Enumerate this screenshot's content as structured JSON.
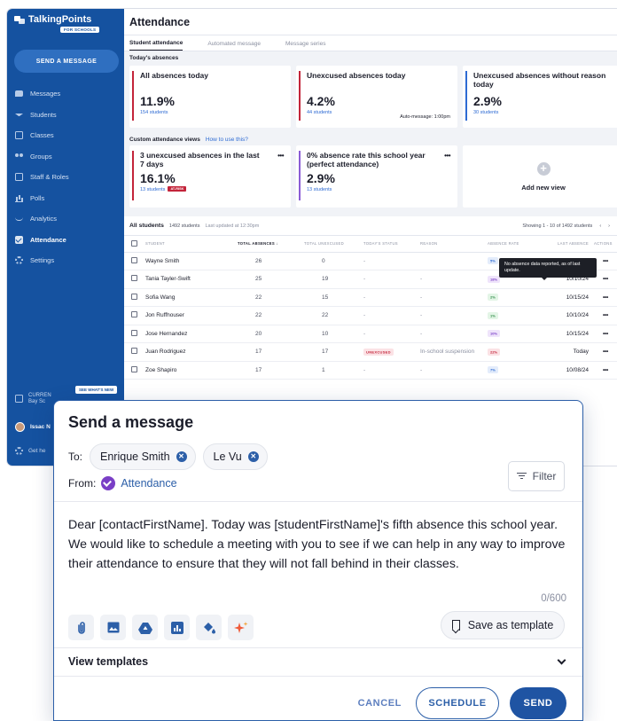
{
  "sidebar": {
    "logo": "TalkingPoints",
    "logo_sub": "FOR SCHOOLS",
    "send_button": "SEND A MESSAGE",
    "items": [
      {
        "label": "Messages",
        "icon": "messages-icon"
      },
      {
        "label": "Students",
        "icon": "students-icon"
      },
      {
        "label": "Classes",
        "icon": "classes-icon"
      },
      {
        "label": "Groups",
        "icon": "groups-icon"
      },
      {
        "label": "Staff & Roles",
        "icon": "staff-icon"
      },
      {
        "label": "Polls",
        "icon": "polls-icon"
      },
      {
        "label": "Analytics",
        "icon": "analytics-icon"
      },
      {
        "label": "Attendance",
        "icon": "attendance-icon",
        "active": true
      },
      {
        "label": "Settings",
        "icon": "settings-icon"
      }
    ],
    "whats_new": "SEE WHAT'S NEW",
    "current_label": "CURREN",
    "current_school": "Bay Sc",
    "user_name": "Issac N",
    "help": "Get he"
  },
  "header": {
    "title": "Attendance",
    "tabs": [
      "Student attendance",
      "Automated message",
      "Message series"
    ]
  },
  "today": {
    "heading": "Today's absences",
    "cards": [
      {
        "title": "All absences today",
        "value": "11.9%",
        "sub": "154 students",
        "note": ""
      },
      {
        "title": "Unexcused absences today",
        "value": "4.2%",
        "sub": "44 students",
        "note": "Auto-message: 1:00pm"
      },
      {
        "title": "Unexcused absences without reason today",
        "value": "2.9%",
        "sub": "30 students",
        "note": ""
      }
    ]
  },
  "custom": {
    "heading": "Custom attendance views",
    "link": "How to use this?",
    "cards": [
      {
        "title": "3 unexcused absences in the last 7 days",
        "value": "16.1%",
        "sub": "13 students",
        "badge": "AT-RISK",
        "accent": "#c3243a"
      },
      {
        "title": "0% absence rate this school year (perfect attendance)",
        "value": "2.9%",
        "sub": "13 students",
        "badge": "",
        "accent": "#8a5cd6"
      }
    ],
    "add_label": "Add new view"
  },
  "students": {
    "heading": "All students",
    "count": "1492 students",
    "updated": "Last updated at 12:30pm",
    "showing": "Showing 1 - 10 of 1492 students",
    "columns": [
      "STUDENT",
      "TOTAL ABSENCES",
      "TOTAL UNEXCUSED",
      "TODAY'S STATUS",
      "REASON",
      "ABSENCE RATE",
      "LAST ABSENCE",
      "ACTIONS"
    ],
    "tooltip": "No absence data reported, as of last update.",
    "rows": [
      {
        "name": "Wayne Smith",
        "total": "26",
        "unexcused": "0",
        "status": "-",
        "reason": "",
        "rate": "5%",
        "rate_bg": "#e3ecfb",
        "rate_fg": "#2d6ad3",
        "last": "10/15/24"
      },
      {
        "name": "Tania Tayler-Swift",
        "total": "25",
        "unexcused": "19",
        "status": "-",
        "reason": "-",
        "rate": "18%",
        "rate_bg": "#efe4fb",
        "rate_fg": "#7a3fc6",
        "last": "10/10/24"
      },
      {
        "name": "Sofia Wang",
        "total": "22",
        "unexcused": "15",
        "status": "-",
        "reason": "-",
        "rate": "2%",
        "rate_bg": "#e3f5e6",
        "rate_fg": "#2e8b47",
        "last": "10/15/24"
      },
      {
        "name": "Jon Ruffhouser",
        "total": "22",
        "unexcused": "22",
        "status": "-",
        "reason": "-",
        "rate": "1%",
        "rate_bg": "#e3f5e6",
        "rate_fg": "#2e8b47",
        "last": "10/10/24"
      },
      {
        "name": "Jose Hernandez",
        "total": "20",
        "unexcused": "10",
        "status": "-",
        "reason": "-",
        "rate": "10%",
        "rate_bg": "#efe4fb",
        "rate_fg": "#7a3fc6",
        "last": "10/15/24"
      },
      {
        "name": "Juan Rodriguez",
        "total": "17",
        "unexcused": "17",
        "status": "UNEXCUSED",
        "reason": "In-school suspension",
        "rate": "22%",
        "rate_bg": "#fbe2e5",
        "rate_fg": "#c3243a",
        "last": "Today"
      },
      {
        "name": "Zoe Shapiro",
        "total": "17",
        "unexcused": "1",
        "status": "-",
        "reason": "-",
        "rate": "7%",
        "rate_bg": "#e3ecfb",
        "rate_fg": "#2d6ad3",
        "last": "10/08/24"
      }
    ]
  },
  "dialog": {
    "title": "Send a message",
    "to_label": "To:",
    "recipients": [
      "Enrique Smith",
      "Le Vu"
    ],
    "from_label": "From:",
    "from_value": "Attendance",
    "filter": "Filter",
    "body": "Dear [contactFirstName]. Today was [studentFirstName]'s fifth absence this school year. We would like to schedule a meeting with you to see if we can help in any way to improve their attendance to ensure that they will not fall behind in their classes.",
    "counter": "0/600",
    "tools": [
      "attachment-icon",
      "image-icon",
      "google-drive-icon",
      "chart-icon",
      "paint-bucket-icon",
      "sparkle-icon"
    ],
    "save_template": "Save as template",
    "view_templates": "View templates",
    "cancel": "CANCEL",
    "schedule": "SCHEDULE",
    "send": "SEND"
  }
}
